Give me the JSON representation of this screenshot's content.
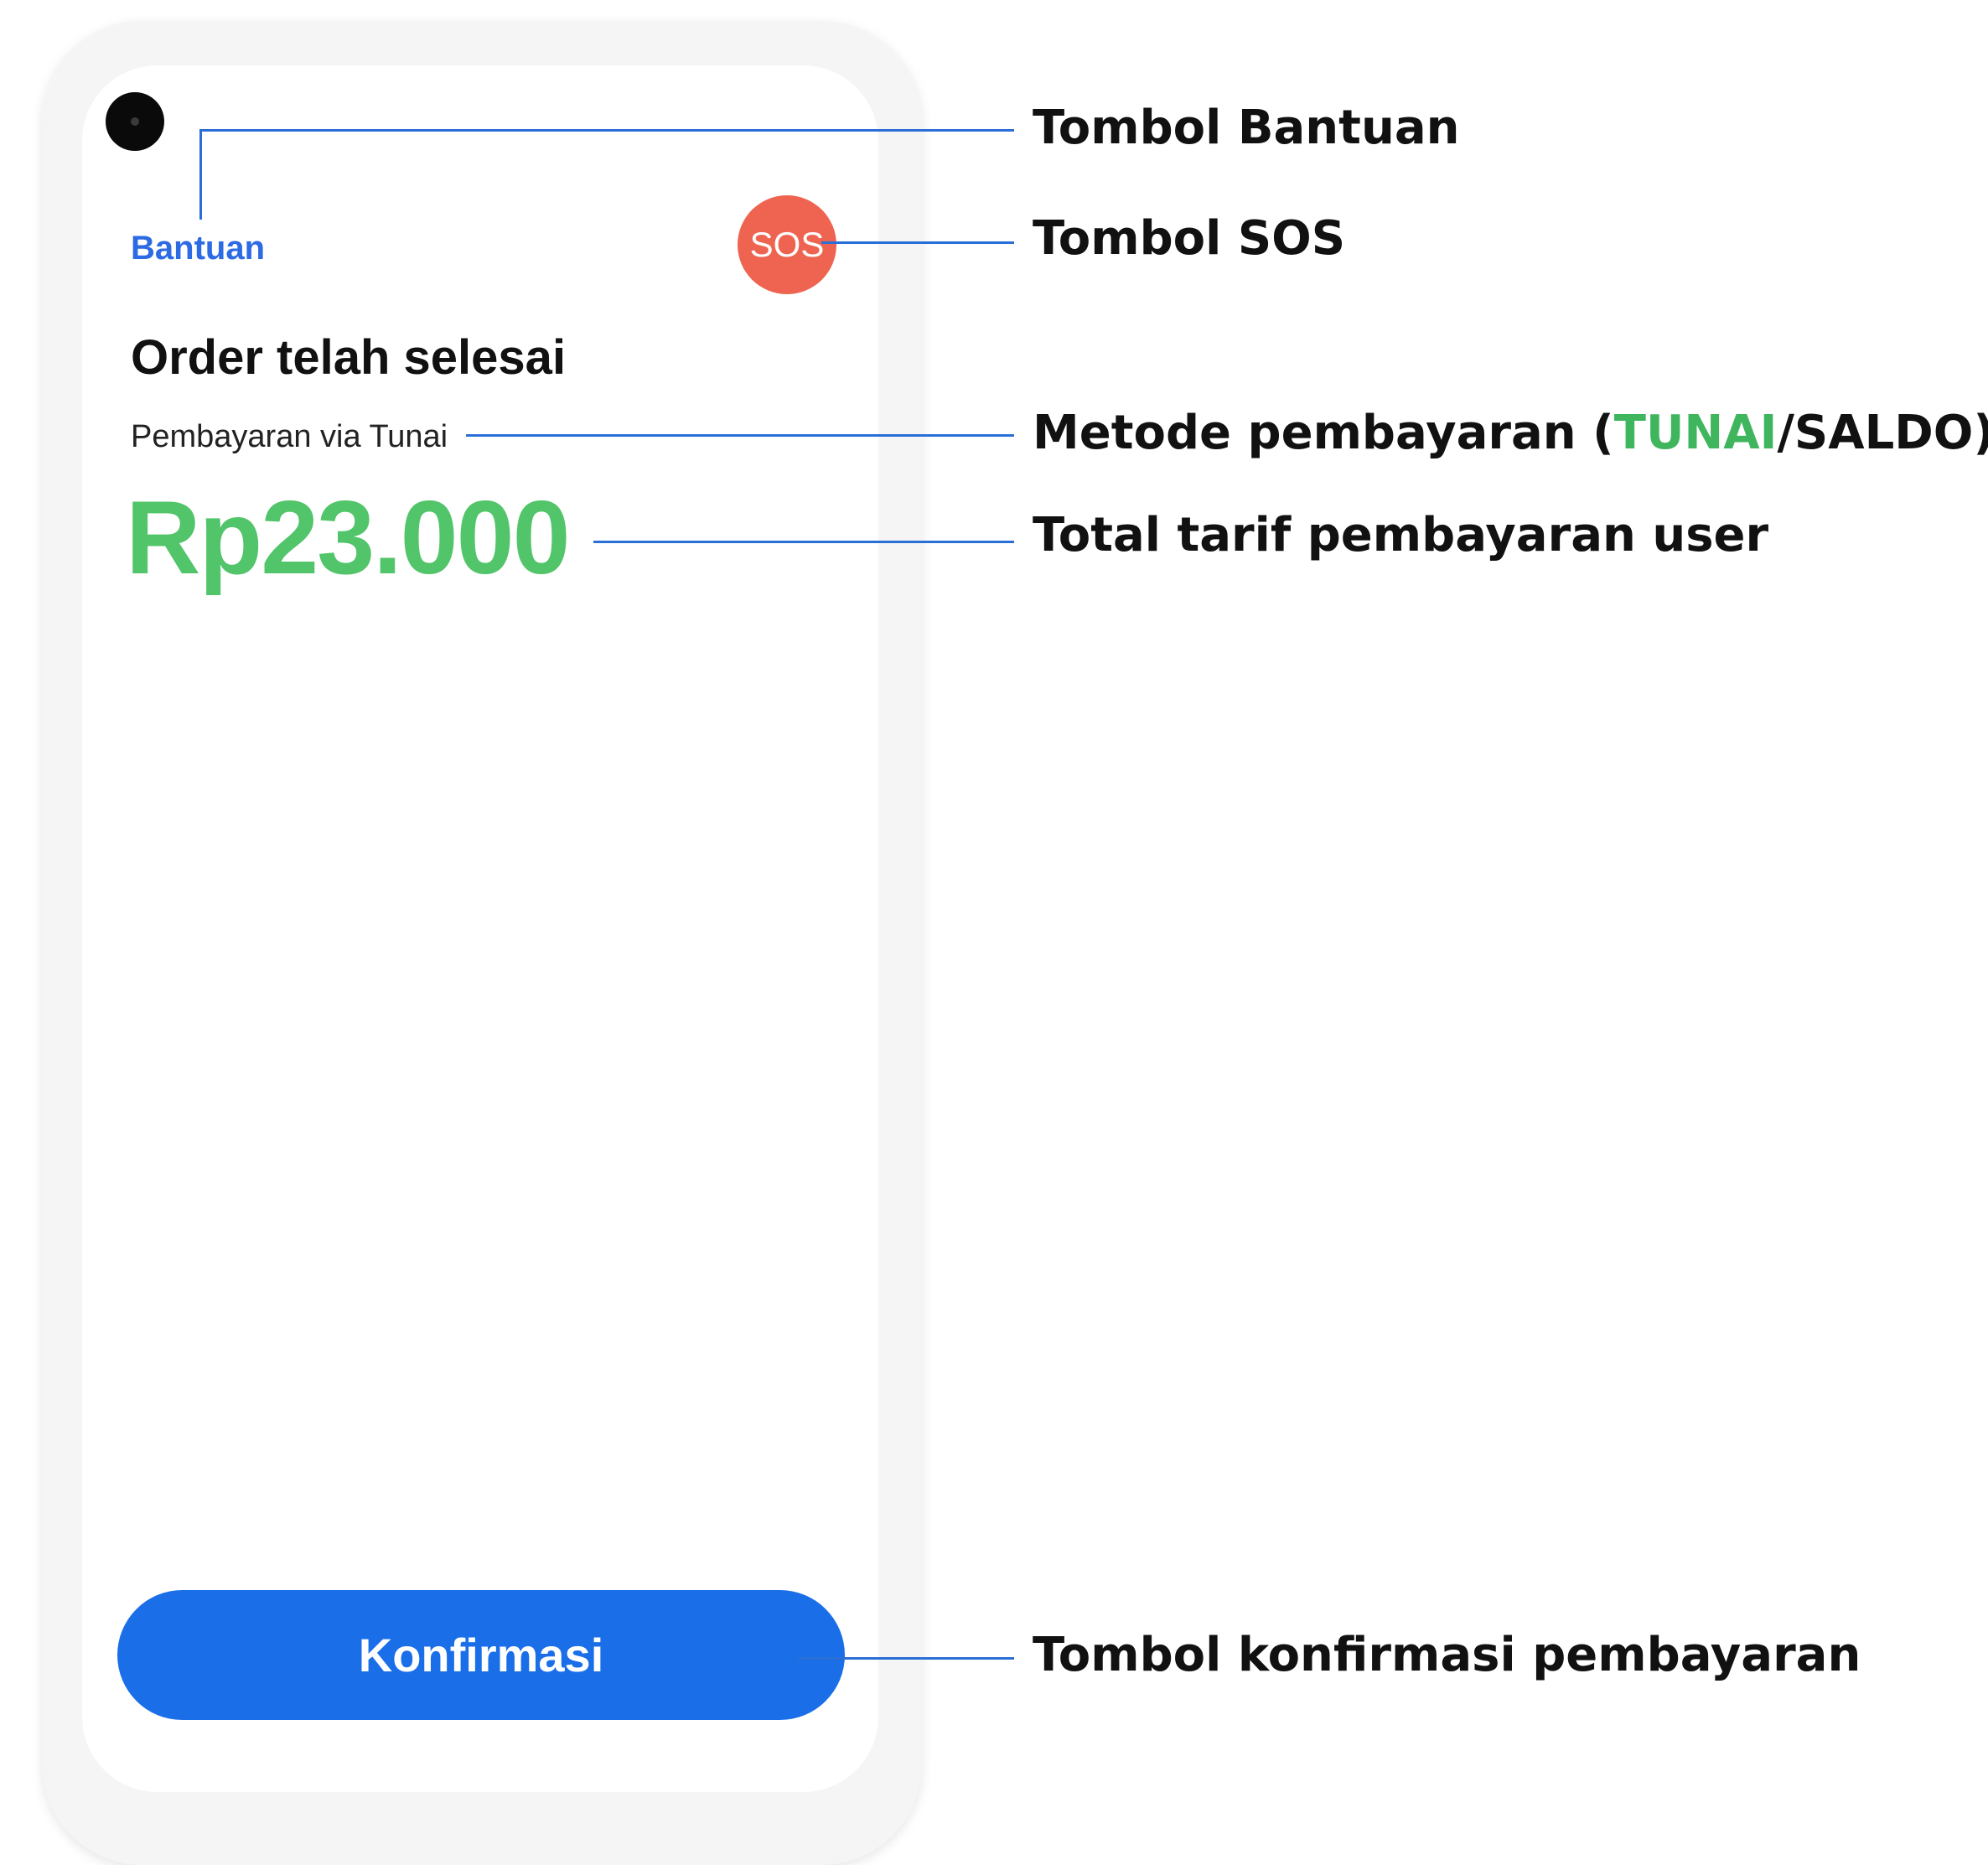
{
  "screen": {
    "help_label": "Bantuan",
    "sos_label": "SOS",
    "order_status": "Order telah selesai",
    "payment_method": "Pembayaran via Tunai",
    "total_amount": "Rp23.000",
    "confirm_label": "Konfirmasi"
  },
  "annotations": {
    "help_button": "Tombol Bantuan",
    "sos_button": "Tombol SOS",
    "payment_method_prefix": "Metode pembayaran (",
    "payment_method_cash": "TUNAI",
    "payment_method_suffix": "/SALDO)",
    "total_fare": "Total tarif pembayaran user",
    "confirm_button": "Tombol konfirmasi pembayaran"
  },
  "colors": {
    "accent_blue": "#1a6fe8",
    "help_blue": "#2d6be4",
    "amount_green": "#52c46a",
    "sos_red": "#ee6450",
    "annotation_line": "#2a6fd6"
  }
}
